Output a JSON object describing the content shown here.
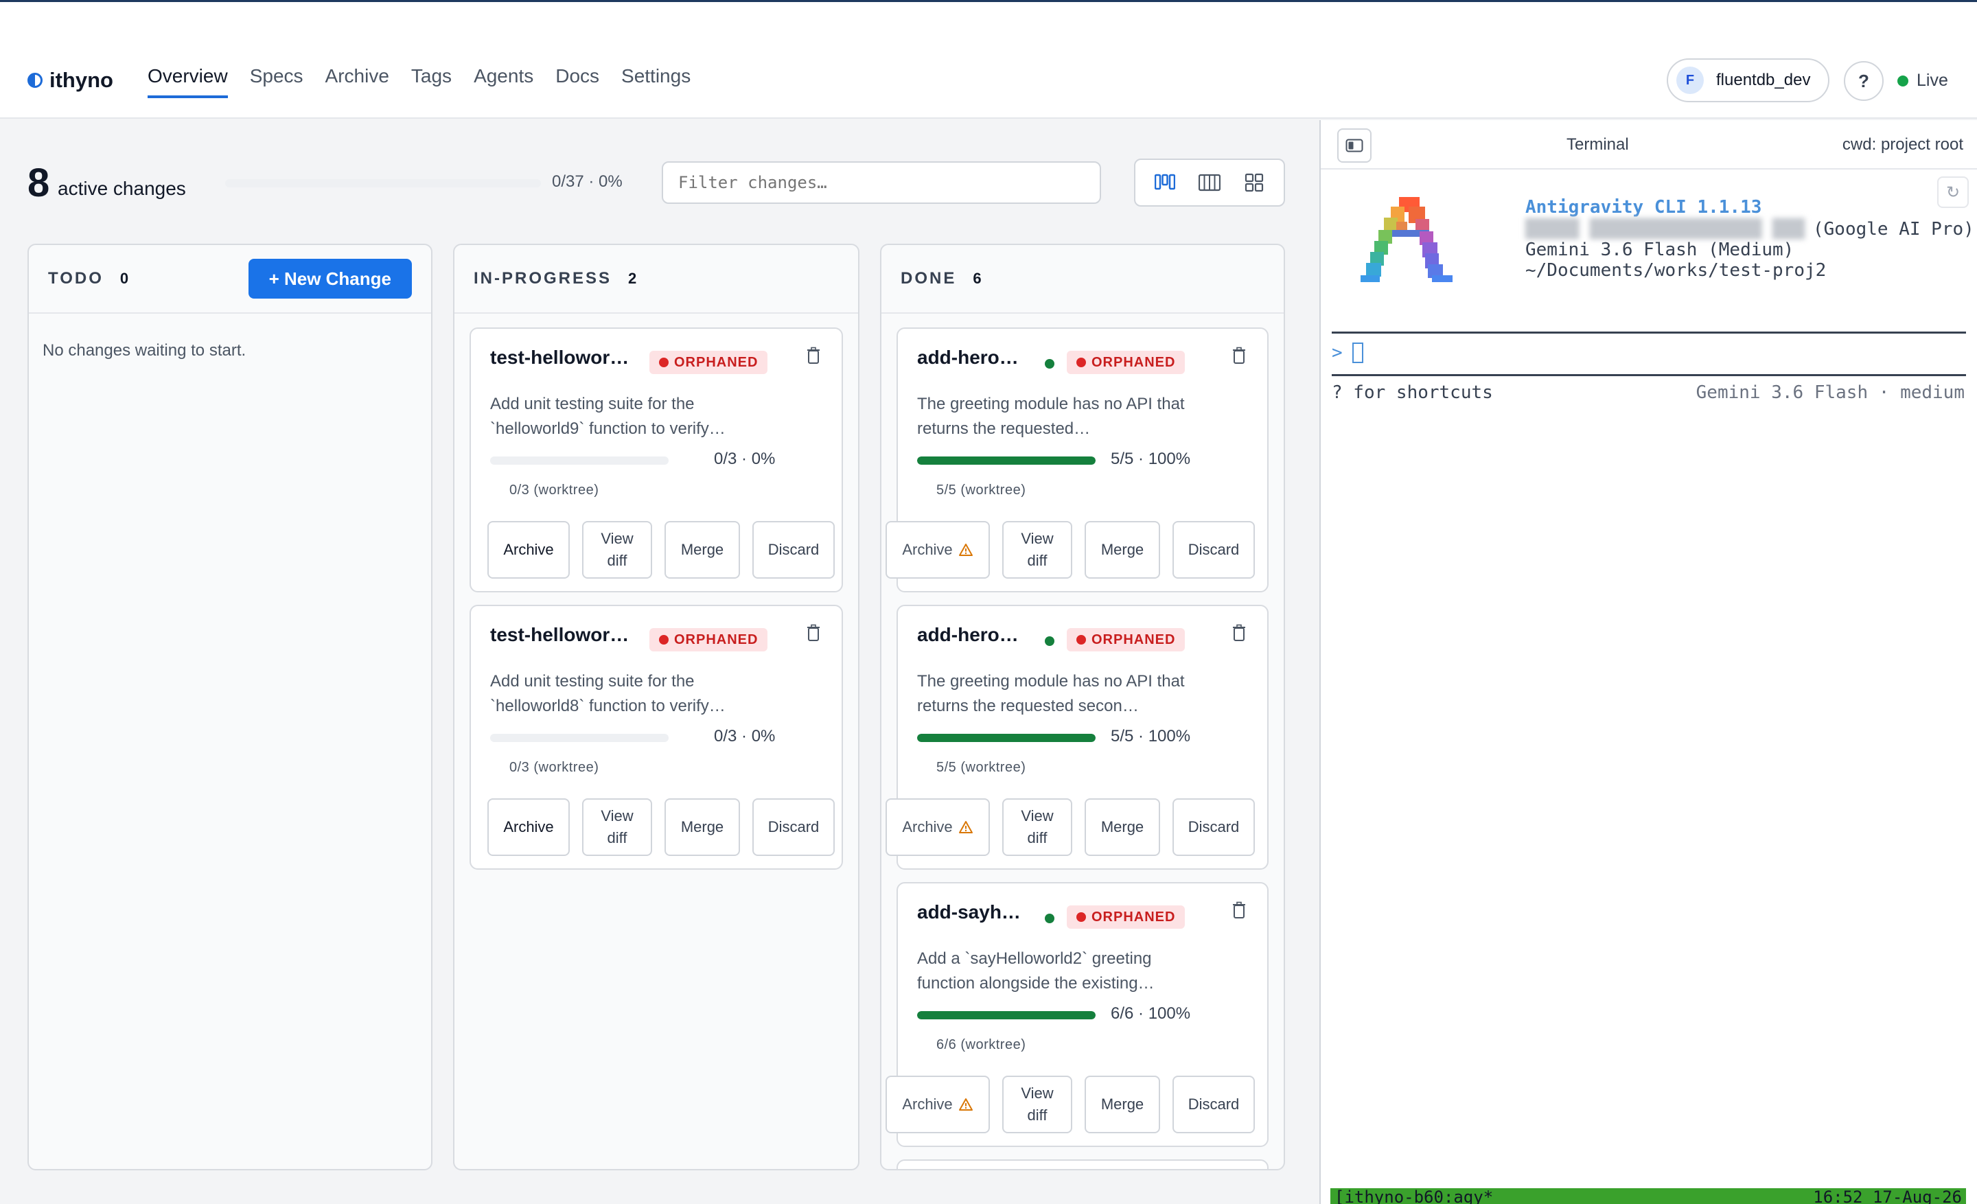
{
  "app": {
    "name": "ithyno",
    "nav": [
      {
        "label": "Overview",
        "active": true
      },
      {
        "label": "Specs"
      },
      {
        "label": "Archive"
      },
      {
        "label": "Tags"
      },
      {
        "label": "Agents"
      },
      {
        "label": "Docs"
      },
      {
        "label": "Settings"
      }
    ],
    "user": {
      "initial": "F",
      "name": "fluentdb_dev"
    },
    "help_label": "?",
    "live_label": "Live"
  },
  "summary": {
    "count": "8",
    "label": "active changes",
    "progress_text": "0/37 · 0%",
    "progress_fraction": 0
  },
  "filter": {
    "placeholder": "Filter changes…",
    "value": ""
  },
  "view_modes": [
    "board-compact-icon",
    "board-columns-icon",
    "grid-icon"
  ],
  "columns": [
    {
      "title": "TODO",
      "count": "0",
      "new_button": "+ New Change",
      "empty_text": "No changes waiting to start.",
      "cards": []
    },
    {
      "title": "IN-PROGRESS",
      "count": "2",
      "cards": [
        {
          "title": "test-hellowor…",
          "badge": "ORPHANED",
          "description": "Add unit testing suite for the `helloworld9` function to verify…",
          "progress_text": "0/3 · 0%",
          "progress_fraction": 0,
          "sub": "0/3 (worktree)",
          "actions": {
            "archive": "Archive",
            "view": "View diff",
            "merge": "Merge",
            "discard": "Discard"
          }
        },
        {
          "title": "test-hellowor…",
          "badge": "ORPHANED",
          "description": "Add unit testing suite for the `helloworld8` function to verify…",
          "progress_text": "0/3 · 0%",
          "progress_fraction": 0,
          "sub": "0/3 (worktree)",
          "actions": {
            "archive": "Archive",
            "view": "View diff",
            "merge": "Merge",
            "discard": "Discard"
          }
        }
      ]
    },
    {
      "title": "DONE",
      "count": "6",
      "cards": [
        {
          "title": "add-hero…",
          "badge": "ORPHANED",
          "description": "The greeting module has no API that returns the requested…",
          "progress_text": "5/5 · 100%",
          "progress_fraction": 1,
          "sub": "5/5 (worktree)",
          "actions": {
            "archive": "Archive",
            "view": "View diff",
            "merge": "Merge",
            "discard": "Discard"
          }
        },
        {
          "title": "add-hero…",
          "badge": "ORPHANED",
          "description": "The greeting module has no API that returns the requested secon…",
          "progress_text": "5/5 · 100%",
          "progress_fraction": 1,
          "sub": "5/5 (worktree)",
          "actions": {
            "archive": "Archive",
            "view": "View diff",
            "merge": "Merge",
            "discard": "Discard"
          }
        },
        {
          "title": "add-sayh…",
          "badge": "ORPHANED",
          "description": "Add a `sayHelloworld2` greeting function alongside the existing…",
          "progress_text": "6/6 · 100%",
          "progress_fraction": 1,
          "sub": "6/6 (worktree)",
          "actions": {
            "archive": "Archive",
            "view": "View diff",
            "merge": "Merge",
            "discard": "Discard"
          }
        }
      ]
    }
  ],
  "terminal": {
    "title": "Terminal",
    "cwd": "cwd: project root",
    "refresh_icon": "↻",
    "cli_name": "Antigravity CLI 1.1.13",
    "account_redacted": "█████ ████████████████ ███",
    "account_plan": "(Google AI Pro)",
    "model_line": "Gemini 3.6 Flash (Medium)",
    "path": "~/Documents/works/test-proj2",
    "prompt": ">",
    "shortcuts_hint": "? for shortcuts",
    "model_status": "Gemini 3.6 Flash · medium",
    "statusbar_left": "[ithyno-b60:agy*",
    "statusbar_right": "16:52 17-Aug-26",
    "colors": {
      "accent": "#4a90d9",
      "statusbar": "#3aa12c"
    }
  },
  "colors": {
    "primary": "#1a73e8",
    "orphaned_bg": "#fde2e4",
    "orphaned_text": "#c81e1e",
    "progress_done": "#15803d",
    "live": "#16a34a"
  }
}
